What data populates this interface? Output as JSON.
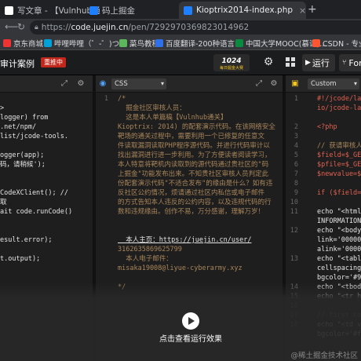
{
  "browser": {
    "tabs": [
      {
        "label": "写文章 - 【Vulnhub通关】",
        "active": false
      },
      {
        "label": "码上掘金",
        "active": false
      },
      {
        "label": "Kioptrix2014-index.php",
        "active": true
      }
    ],
    "url_domain": "code.juejin.cn",
    "url_scheme": "https://",
    "url_path": "/pen/7292970369823014962",
    "bookmarks": [
      "京东商城",
      "哔哩哔哩（゜-゜)つロ ...",
      "菜鸟教程",
      "百度翻译-200种语言...",
      "中国大学MOOC(慕课)...",
      "CSDN - 专业开"
    ]
  },
  "header": {
    "title": "审计案例",
    "badge": "重推中",
    "logo": "1024 每日掘金大赛",
    "run_label": "运行",
    "fork_label": "Fork"
  },
  "panels": {
    "left": {
      "lines": [
        "",
        ">",
        "logger) from",
        ".net/npm/",
        "list/jcode-tools.",
        "",
        "ogger(app);",
        "码，请稍候');",
        "",
        "",
        "CodeXClient(); //",
        "取",
        "ait code.runCode()",
        "",
        "",
        "esult.error);",
        "",
        "t.output);"
      ]
    },
    "middle": {
      "language": "CSS",
      "lines": [
        "/*",
        "  掘金社区审核人员：",
        "  这是本人单篇稿【Vulnhub通关】",
        "Kioptrix: 2014) 的配套演示代码。在该网络安全",
        "靶场的通关过程中，需要利用一个已修复的任意文",
        "件读取漏洞读取PHP程序源代码。并进行代码审计以",
        "找出漏洞进行进一步利用。为了方便读者阅读学习，",
        "本人特意将靶机内读取到的源代码通过贵社区的\"码",
        "上掘金\"功能发布出来。不知贵社区审核人员判定此",
        "份配套演示代码\"不适合发布\"的缘由是什么？如有违",
        "反社区公约情况，烦请通过社区内私信或电子邮件",
        "的方式告知本人违反的公约内容，以及违规代码的行",
        "数和违规缘由。创作不易，万分感谢，理解万岁！",
        "",
        "",
        "  本人主页：https://juejin.cn/user/",
        "3162635869625799",
        "  本人电子邮件：",
        "misaka19008@liyue-cyberarmy.xyz",
        "",
        "*/"
      ],
      "line_numbers": [
        "1",
        "",
        "",
        "",
        "",
        "",
        "",
        "",
        "",
        "",
        "",
        "",
        "",
        "",
        "",
        "",
        "",
        "",
        "",
        "",
        ""
      ]
    },
    "right": {
      "language": "Custom",
      "lines": [
        "#!/jcode/lang",
        "io/jcode-lang",
        "",
        "<?php",
        "",
        "// 获请审核人员",
        "$field=$_GET",
        "$pfile=$_GET",
        "$newvalue=$_",
        "",
        "if ($field=s",
        "",
        "echo \"<html>",
        "INFORMATION}-",
        "echo \"<body",
        "link='000000",
        "alink='00000",
        "echo \"<table",
        "cellspacing=",
        "bgcolor='#99",
        "echo \"<tbody",
        "echo \"<tr he",
        "",
        "// first colu",
        "echo \"<td va",
        "bgcolor='#ffc"
      ],
      "line_numbers": [
        "1",
        "",
        "",
        "2",
        "3",
        "4",
        "5",
        "6",
        "7",
        "8",
        "9",
        "10",
        "11",
        "",
        "12",
        "",
        "",
        "13",
        "",
        "",
        "14",
        "15",
        "16",
        "17",
        "18",
        ""
      ]
    }
  },
  "overlay": {
    "run_effect_label": "点击查看运行效果",
    "watermark": "@稀土掘金技术社区"
  },
  "colors": {
    "badge": "#c1281b",
    "comment": "#a8855a",
    "keyword_red": "#e0604f"
  }
}
